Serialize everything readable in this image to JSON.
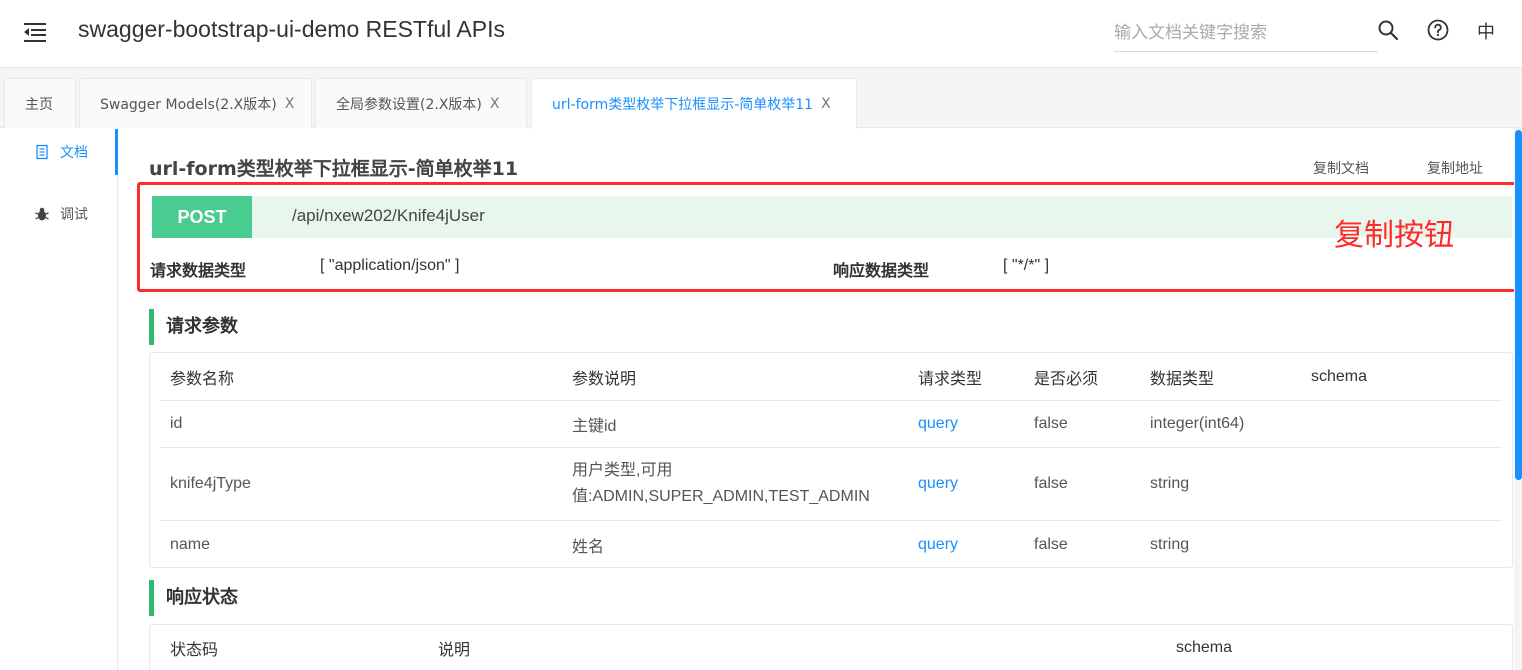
{
  "header": {
    "title": "swagger-bootstrap-ui-demo RESTful APIs",
    "search_placeholder": "输入文档关键字搜索",
    "lang": "中"
  },
  "tabs": [
    {
      "label": "主页",
      "closable": false
    },
    {
      "label": "Swagger Models(2.X版本)",
      "closable": true
    },
    {
      "label": "全局参数设置(2.X版本)",
      "closable": true
    },
    {
      "label": "url-form类型枚举下拉框显示-简单枚举11",
      "closable": true,
      "active": true
    }
  ],
  "tab_close": "X",
  "sidebar": {
    "items": [
      {
        "label": "文档",
        "icon": "document-icon",
        "active": true
      },
      {
        "label": "调试",
        "icon": "bug-icon",
        "active": false
      }
    ]
  },
  "api": {
    "title": "url-form类型枚举下拉框显示-简单枚举11",
    "copy_doc": "复制文档",
    "copy_address": "复制地址",
    "method": "POST",
    "path": "/api/nxew202/Knife4jUser",
    "request_type_label": "请求数据类型",
    "request_type_value": "[ \"application/json\" ]",
    "response_type_label": "响应数据类型",
    "response_type_value": "[ \"*/*\" ]",
    "annotation": "复制按钮"
  },
  "params": {
    "title": "请求参数",
    "headers": [
      "参数名称",
      "参数说明",
      "请求类型",
      "是否必须",
      "数据类型",
      "schema"
    ],
    "rows": [
      {
        "name": "id",
        "desc": "主键id",
        "desc2": "",
        "in": "query",
        "required": "false",
        "type": "integer(int64)",
        "schema": ""
      },
      {
        "name": "knife4jType",
        "desc": "用户类型,可用",
        "desc2": "值:ADMIN,SUPER_ADMIN,TEST_ADMIN",
        "in": "query",
        "required": "false",
        "type": "string",
        "schema": ""
      },
      {
        "name": "name",
        "desc": "姓名",
        "desc2": "",
        "in": "query",
        "required": "false",
        "type": "string",
        "schema": ""
      }
    ]
  },
  "responses": {
    "title": "响应状态",
    "headers": [
      "状态码",
      "说明",
      "schema"
    ]
  },
  "colors": {
    "accent": "#1890ff",
    "post": "#49cc90",
    "section_bar": "#2eb872",
    "annotation": "#ff2b2b"
  }
}
